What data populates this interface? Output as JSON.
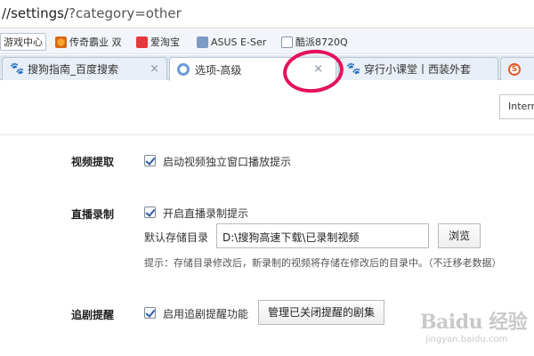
{
  "address_bar": {
    "url_prefix": "//settings/",
    "url_query": "?category=other"
  },
  "bookmarks": [
    {
      "label": "游戏中心",
      "icon": "none"
    },
    {
      "label": "传奇霸业 双",
      "icon": "game-icon"
    },
    {
      "label": "爱淘宝",
      "icon": "taobao-icon"
    },
    {
      "label": "ASUS E-Ser",
      "icon": "folder-icon"
    },
    {
      "label": "酷派8720Q",
      "icon": "doc-icon"
    }
  ],
  "tabs": [
    {
      "label": "搜狗指南_百度搜索",
      "close": "×",
      "active": false
    },
    {
      "label": "选项-高级",
      "close": "×",
      "active": true
    },
    {
      "label": "穿行小课堂丨西装外套",
      "close": "",
      "active": false
    },
    {
      "label": "",
      "close": "",
      "active": false
    }
  ],
  "toolbar": {
    "internet_button": "Intern"
  },
  "sections": {
    "video": {
      "title": "视频提取",
      "option": "启动视频独立窗口播放提示",
      "checked": true
    },
    "live": {
      "title": "直播录制",
      "option": "开启直播录制提示",
      "checked": true,
      "dir_label": "默认存储目录",
      "dir_value": "D:\\搜狗高速下载\\已录制视频",
      "browse_button": "浏览",
      "hint": "提示：存储目录修改后，新录制的视频将存储在修改后的目录中。（不迁移老数据）"
    },
    "follow": {
      "title": "追剧提醒",
      "option": "启用追剧提醒功能",
      "checked": true,
      "manage_button": "管理已关闭提醒的剧集"
    }
  },
  "watermark": {
    "main": "Baidu 经验",
    "sub": "jingyan.baidu.com"
  },
  "colors": {
    "highlight_circle": "#e5105c",
    "checkmark": "#2d5fa8",
    "tab_active": "#ffffff",
    "tab_strip": "#dfe7f1"
  }
}
